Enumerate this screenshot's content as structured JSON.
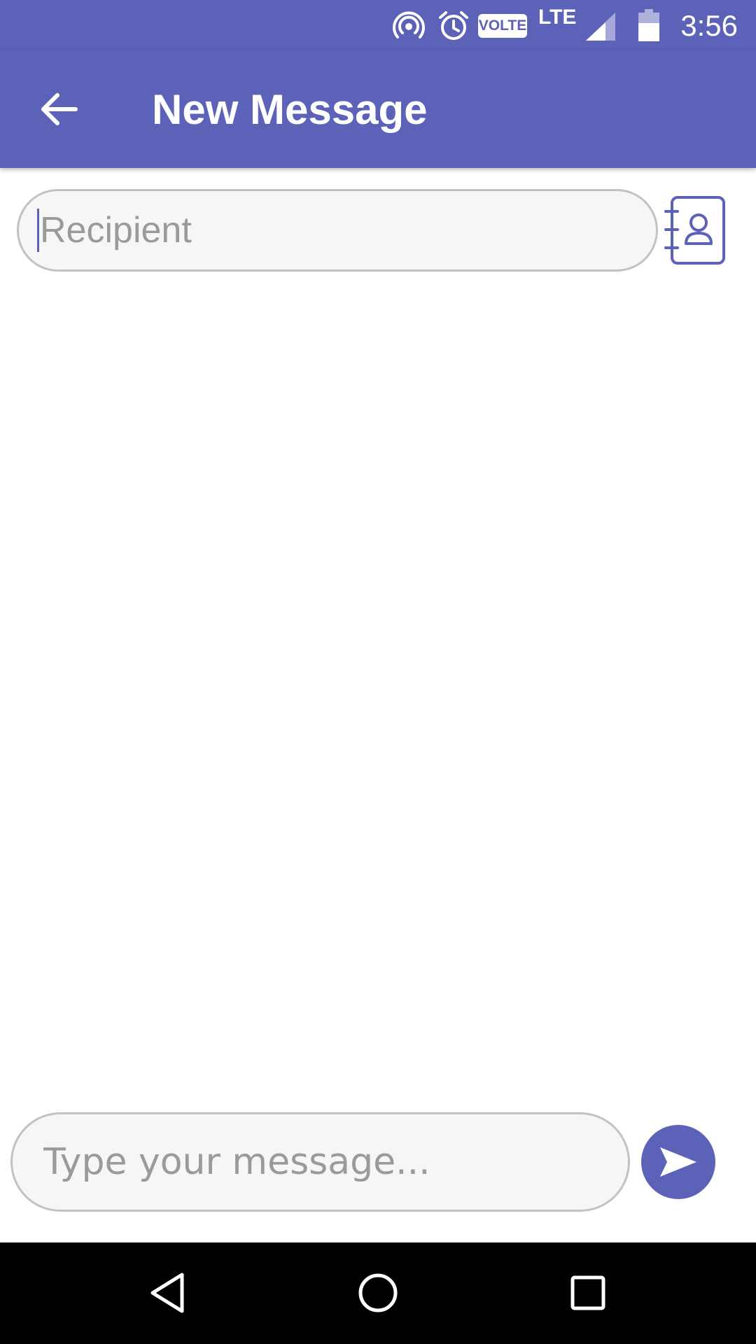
{
  "status_bar": {
    "time": "3:56",
    "network_label": "LTE",
    "volte_label": "VOLTE",
    "icons": [
      "hotspot-icon",
      "alarm-icon",
      "volte-icon",
      "signal-icon",
      "battery-icon"
    ]
  },
  "app_bar": {
    "title": "New Message",
    "back_icon": "arrow-left-icon"
  },
  "recipient": {
    "value": "",
    "placeholder": "Recipient",
    "contacts_icon": "contacts-book-icon"
  },
  "composer": {
    "value": "",
    "placeholder": "Type your message...",
    "send_icon": "send-icon"
  },
  "nav_bar": {
    "items": [
      "back-triangle-icon",
      "home-circle-icon",
      "recents-square-icon"
    ]
  },
  "colors": {
    "primary": "#5c62b8",
    "field_background": "#f6f6f6",
    "field_border": "#c2c2c2",
    "placeholder": "#9a9a9a"
  }
}
